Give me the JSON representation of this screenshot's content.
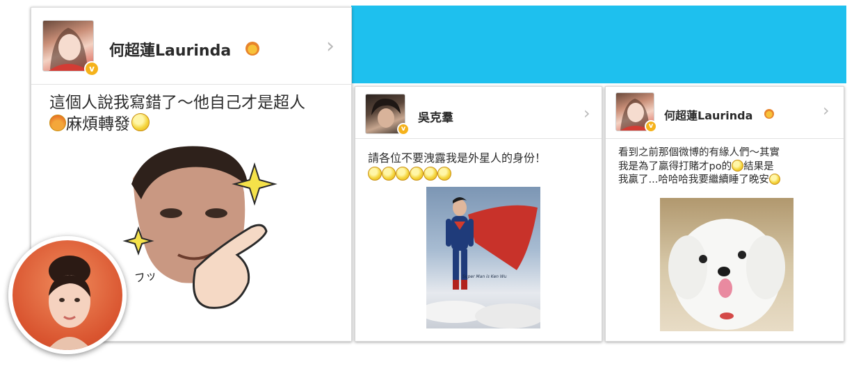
{
  "post1": {
    "username": "何超蓮Laurinda",
    "text_line1": "這個人說我寫錯了～他自己才是超人",
    "text_line2": "麻煩轉發",
    "sticker_caption": "フッ"
  },
  "post2": {
    "username": "吳克羣",
    "text_line1": "請各位不要洩露我是外星人的身份！",
    "poster_caption": "Super Man is Ken Wu"
  },
  "post3": {
    "username": "何超蓮Laurinda",
    "text_line1": "看到之前那個微博的有緣人們～其實",
    "text_line2a": "我是為了贏得打賭才po的",
    "text_line2b": "結果是",
    "text_line3": "我贏了...哈哈哈我要繼續睡了晚安"
  },
  "colors": {
    "banner_blue": "#1ec0ee",
    "badge_gold": "#f5b21b",
    "text_dark": "#2b2b2b"
  },
  "icons": {
    "chevron": "›",
    "vip_badge": "v"
  }
}
